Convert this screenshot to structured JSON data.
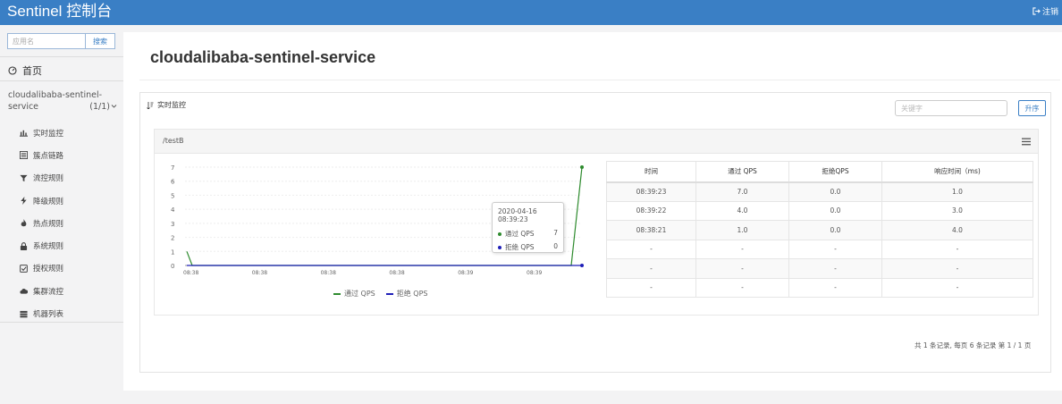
{
  "app": {
    "brand": "Sentinel 控制台",
    "logout_label": "注销"
  },
  "sidebar": {
    "search_placeholder": "应用名",
    "search_button": "搜索",
    "home_label": "首页",
    "app_name": "cloudalibaba-sentinel-service",
    "app_count": "(1/1)",
    "items": [
      {
        "label": "实时监控",
        "icon": "bar-chart-icon"
      },
      {
        "label": "簇点链路",
        "icon": "list-icon"
      },
      {
        "label": "流控规则",
        "icon": "filter-icon"
      },
      {
        "label": "降级规则",
        "icon": "bolt-icon"
      },
      {
        "label": "热点规则",
        "icon": "fire-icon"
      },
      {
        "label": "系统规则",
        "icon": "lock-icon"
      },
      {
        "label": "授权规则",
        "icon": "check-icon"
      },
      {
        "label": "集群流控",
        "icon": "cloud-icon"
      },
      {
        "label": "机器列表",
        "icon": "server-icon"
      }
    ]
  },
  "main": {
    "title": "cloudalibaba-sentinel-service",
    "panel_title": "实时监控",
    "keyword_placeholder": "关键字",
    "sort_button": "升序",
    "resource": "/testB",
    "tooltip": {
      "time": "2020-04-16 08:39:23",
      "pass_label": "通过 QPS",
      "pass_value": "7",
      "block_label": "拒绝 QPS",
      "block_value": "0"
    },
    "table": {
      "headers": [
        "时间",
        "通过 QPS",
        "拒绝QPS",
        "响应时间（ms)"
      ],
      "rows": [
        [
          "08:39:23",
          "7.0",
          "0.0",
          "1.0"
        ],
        [
          "08:39:22",
          "4.0",
          "0.0",
          "3.0"
        ],
        [
          "08:38:21",
          "1.0",
          "0.0",
          "4.0"
        ],
        [
          "-",
          "-",
          "-",
          "-"
        ],
        [
          "-",
          "-",
          "-",
          "-"
        ],
        [
          "-",
          "-",
          "-",
          "-"
        ]
      ]
    },
    "pager": "共 1 条记录, 每页 6 条记录 第 1 / 1 页"
  },
  "colors": {
    "topbar": "#3a7fc5",
    "pass": "#2e8b2e",
    "block": "#1f1fb8"
  },
  "chart_data": {
    "type": "line",
    "x": [
      "08:38",
      "08:38",
      "08:38",
      "08:38",
      "08:39",
      "08:39"
    ],
    "yticks": [
      "0",
      "1",
      "2",
      "3",
      "4",
      "5",
      "6",
      "7"
    ],
    "ylim": [
      0,
      7
    ],
    "series": [
      {
        "name": "通过 QPS",
        "color": "#2e8b2e",
        "values": [
          1,
          0,
          0,
          0,
          0,
          0,
          0,
          7
        ]
      },
      {
        "name": "拒绝 QPS",
        "color": "#1f1fb8",
        "values": [
          0,
          0,
          0,
          0,
          0,
          0,
          0,
          0
        ]
      }
    ],
    "legend_position": "bottom"
  }
}
